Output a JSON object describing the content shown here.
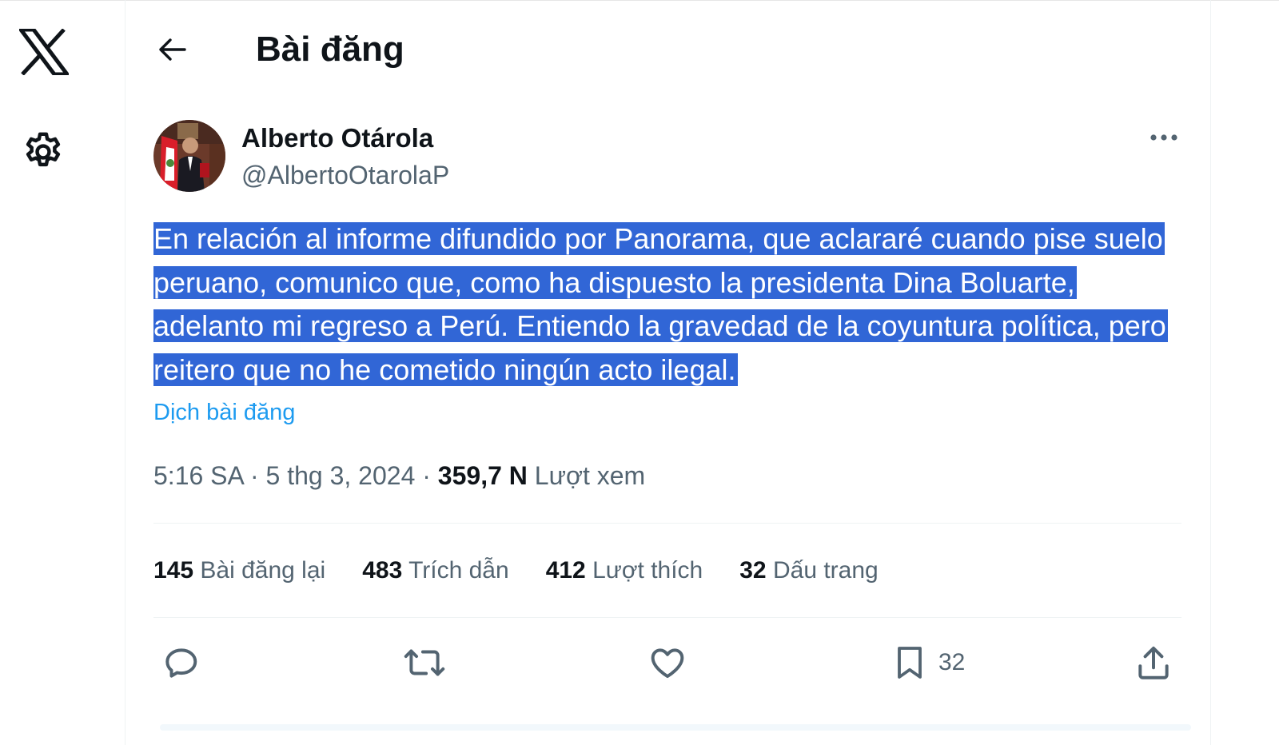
{
  "header": {
    "title": "Bài đăng",
    "back_icon": "arrow-left-icon"
  },
  "nav": {
    "logo_icon": "x-logo-icon",
    "settings_icon": "gear-icon"
  },
  "post": {
    "author": {
      "name": "Alberto Otárola",
      "handle": "@AlbertoOtarolaP",
      "avatar_icon": "avatar-photo"
    },
    "more_icon": "more-dots-icon",
    "text": "En relación al informe difundido por Panorama, que aclararé cuando pise suelo peruano, comunico que, como ha dispuesto la presidenta Dina Boluarte, adelanto mi regreso a Perú. Entiendo la gravedad de la coyuntura política, pero reitero que no he cometido ningún acto ilegal.",
    "translate_label": "Dịch bài đăng",
    "time": "5:16 SA",
    "date": "5 thg 3, 2024",
    "separator": "·",
    "views_count": "359,7 N",
    "views_label": "Lượt xem"
  },
  "stats": [
    {
      "count": "145",
      "label": "Bài đăng lại"
    },
    {
      "count": "483",
      "label": "Trích dẫn"
    },
    {
      "count": "412",
      "label": "Lượt thích"
    },
    {
      "count": "32",
      "label": "Dấu trang"
    }
  ],
  "actions": {
    "reply_icon": "reply-icon",
    "repost_icon": "repost-icon",
    "like_icon": "heart-icon",
    "bookmark_icon": "bookmark-icon",
    "bookmark_count": "32",
    "share_icon": "share-icon"
  },
  "colors": {
    "selection_highlight": "#3166d6",
    "link": "#1d9bf0",
    "secondary_text": "#536471",
    "primary_text": "#0f1419"
  }
}
